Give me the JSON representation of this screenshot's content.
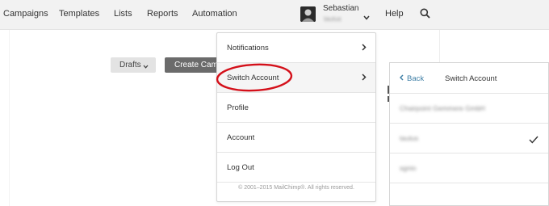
{
  "nav": {
    "items": [
      "Campaigns",
      "Templates",
      "Lists",
      "Reports",
      "Automation"
    ],
    "user_name": "Sebastian",
    "user_sub": "tautus",
    "help_label": "Help"
  },
  "toolbar": {
    "drafts_label": "Drafts",
    "create_label": "Create Campaign"
  },
  "menu": {
    "items": [
      "Notifications",
      "Switch Account",
      "Profile",
      "Account",
      "Log Out"
    ],
    "footer": "© 2001–2015 MailChimp®. All rights reserved."
  },
  "switch_panel": {
    "back_label": "Back",
    "title": "Switch Account",
    "accounts": [
      "Chairpoint Gemmere GmbH",
      "tautus",
      "sgnio"
    ],
    "selected_index": 1
  },
  "colors": {
    "accent_link": "#3f7fa6",
    "annotation": "#d4101a",
    "create_button": "#6b6b6b"
  }
}
